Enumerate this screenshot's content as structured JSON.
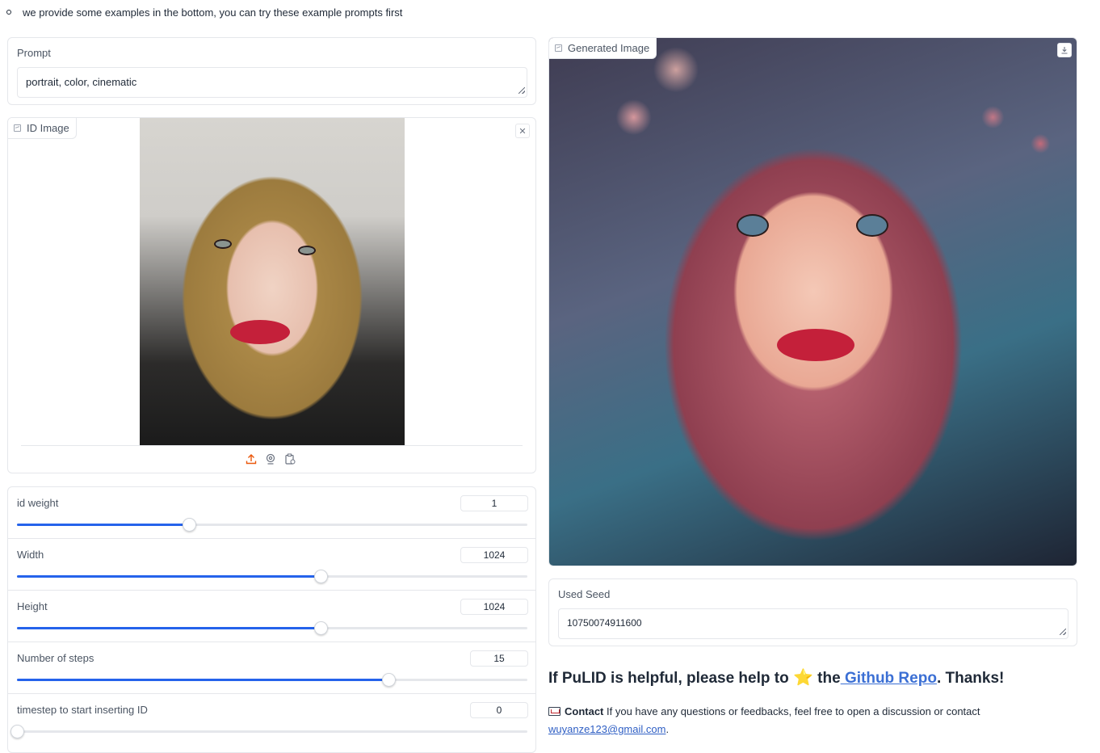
{
  "notice": {
    "text": "we provide some examples in the bottom, you can try these example prompts first"
  },
  "prompt": {
    "label": "Prompt",
    "value": "portrait, color, cinematic"
  },
  "id_image": {
    "label": "ID Image"
  },
  "sliders": [
    {
      "label": "id weight",
      "value": "1",
      "fraction": 0.337
    },
    {
      "label": "Width",
      "value": "1024",
      "fraction": 0.595
    },
    {
      "label": "Height",
      "value": "1024",
      "fraction": 0.595
    },
    {
      "label": "Number of steps",
      "value": "15",
      "fraction": 0.728
    },
    {
      "label": "timestep to start inserting ID",
      "value": "0",
      "fraction": 0.0
    }
  ],
  "generated": {
    "label": "Generated Image"
  },
  "seed": {
    "label": "Used Seed",
    "value": "10750074911600"
  },
  "footer": {
    "prefix": "If PuLID is helpful, please help to",
    "star": "⭐",
    "mid": "the",
    "link": " Github Repo",
    "suffix": ". Thanks!",
    "contact_bold": "Contact",
    "contact_text": " If you have any questions or feedbacks, feel free to open a discussion or contact",
    "email": "wuyanze123@gmail.com",
    "period": "."
  },
  "colors": {
    "accent": "#2563eb",
    "link": "#3b6fd4",
    "upload_icon": "#ea580c"
  }
}
